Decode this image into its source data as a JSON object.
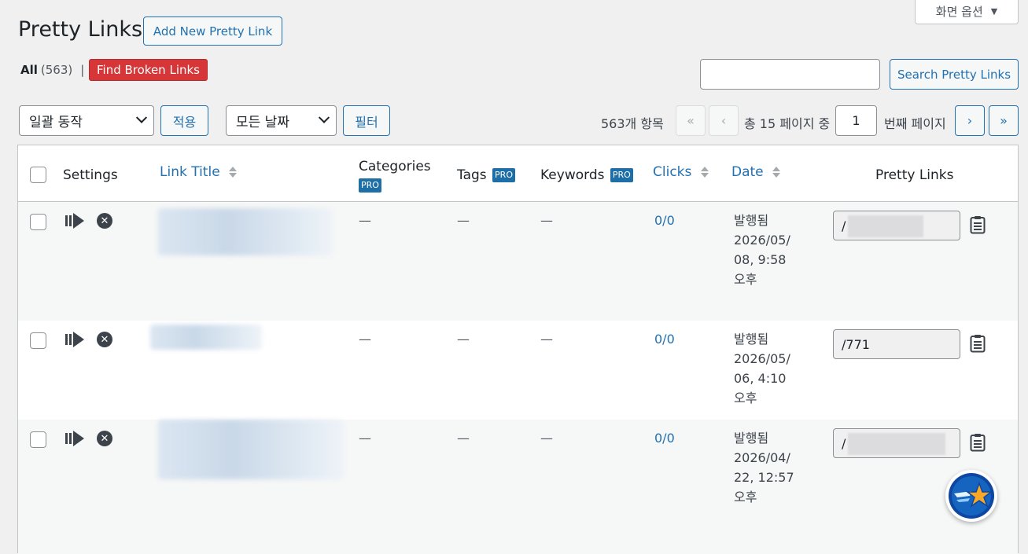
{
  "screen_options": {
    "label": "화면 옵션"
  },
  "header": {
    "title": "Pretty Links",
    "add_new_label": "Add New Pretty Link"
  },
  "views": {
    "all_label": "All",
    "all_count": "(563)",
    "separator": "|",
    "broken_label": "Find Broken Links"
  },
  "search": {
    "value": "",
    "button_label": "Search Pretty Links"
  },
  "tablenav": {
    "bulk_action": "일괄 동작",
    "apply_label": "적용",
    "date_filter": "모든 날짜",
    "filter_label": "필터",
    "items_count": "563개 항목",
    "first_label": "«",
    "prev_label": "‹",
    "total_prefix": "총 15 페이지 중",
    "current_page": "1",
    "page_suffix": "번째 페이지",
    "next_label": "›",
    "last_label": "»"
  },
  "columns": {
    "settings": "Settings",
    "link_title": "Link Title",
    "categories": "Categories",
    "tags": "Tags",
    "keywords": "Keywords",
    "clicks": "Clicks",
    "date": "Date",
    "pretty_links": "Pretty Links",
    "pro_badge": "PRO"
  },
  "rows": [
    {
      "categories": "—",
      "tags": "—",
      "keywords": "—",
      "clicks": "0/0",
      "date_status": "발행됨",
      "date_line1": "2026/05/",
      "date_line2": "08, 9:58",
      "date_line3": "오후",
      "pretty_link": "/"
    },
    {
      "categories": "—",
      "tags": "—",
      "keywords": "—",
      "clicks": "0/0",
      "date_status": "발행됨",
      "date_line1": "2026/05/",
      "date_line2": "06, 4:10",
      "date_line3": "오후",
      "pretty_link": "/771"
    },
    {
      "categories": "—",
      "tags": "—",
      "keywords": "—",
      "clicks": "0/0",
      "date_status": "발행됨",
      "date_line1": "2026/04/",
      "date_line2": "22, 12:57",
      "date_line3": "오후",
      "pretty_link": "/"
    }
  ],
  "colors": {
    "accent": "#2271b1",
    "danger": "#d63638",
    "pro": "#1e6fa8"
  }
}
